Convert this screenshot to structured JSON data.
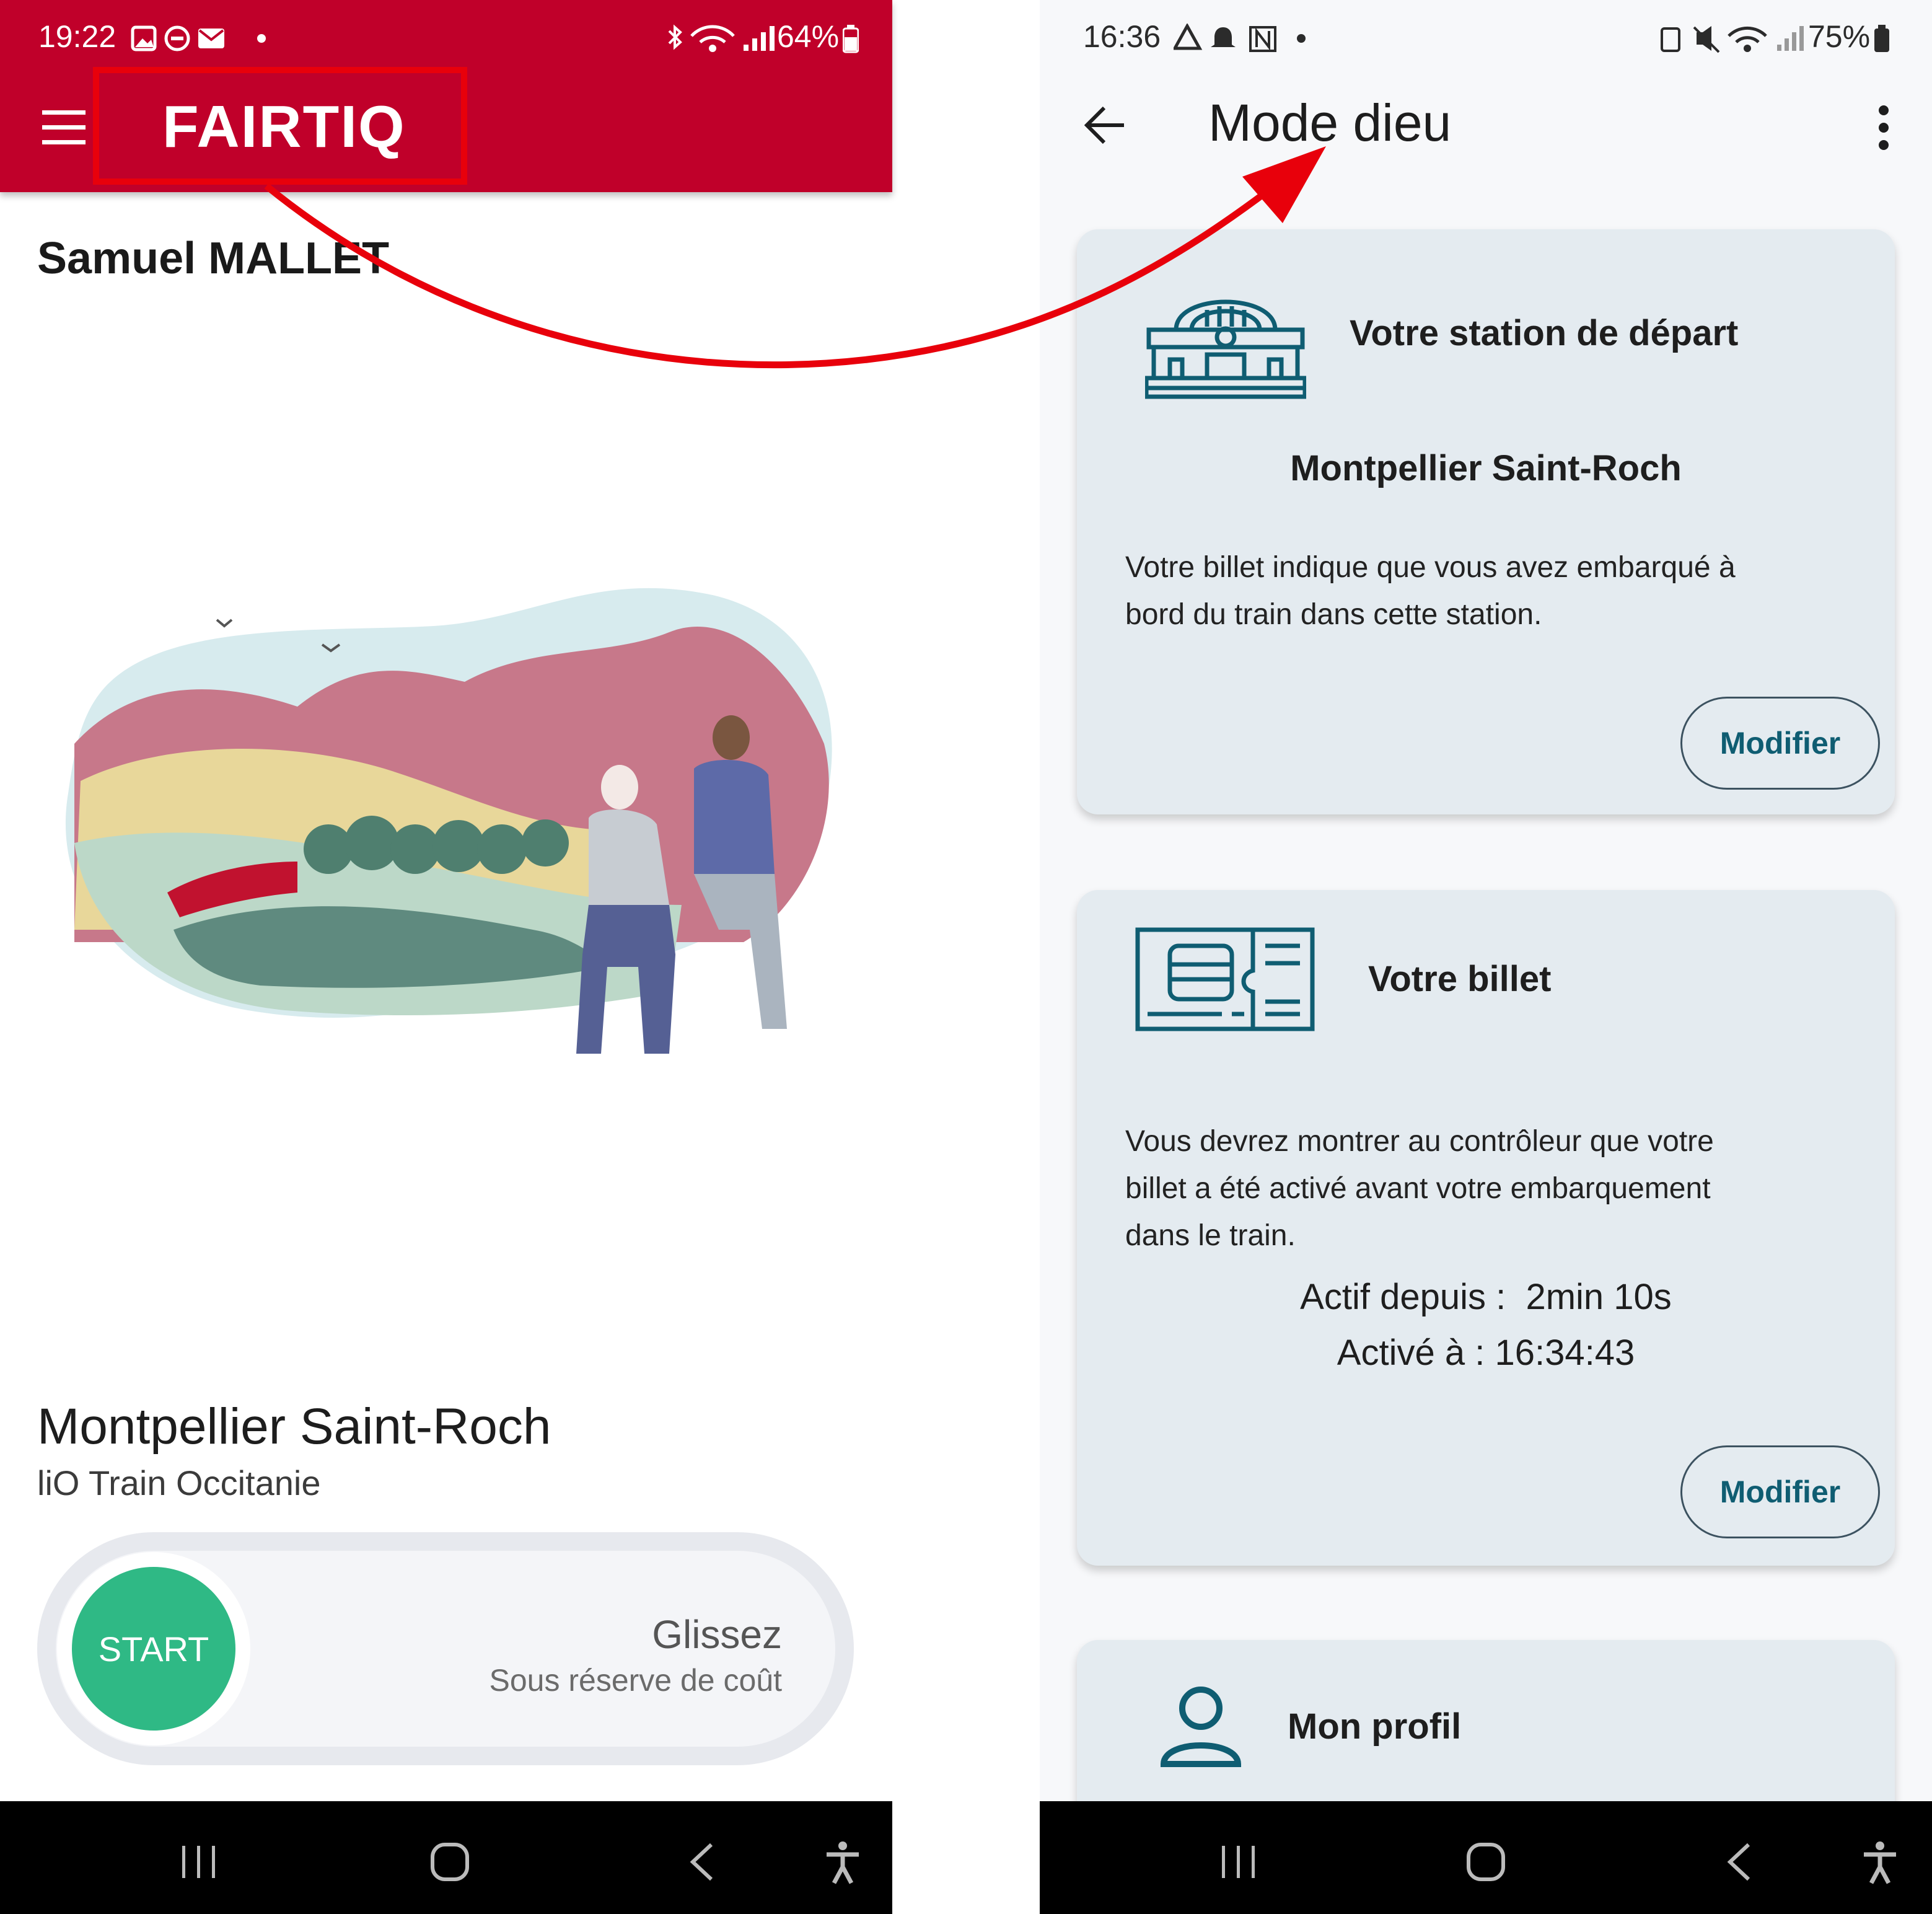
{
  "left": {
    "status": {
      "time": "19:22",
      "battery": "64%"
    },
    "header": {
      "logo": "FAIRTIQ"
    },
    "user_name": "Samuel MALLET",
    "station": "Montpellier Saint-Roch",
    "operator": "liO Train Occitanie",
    "start_label": "START",
    "slide_title": "Glissez",
    "slide_sub": "Sous réserve de coût"
  },
  "right": {
    "status": {
      "time": "16:36",
      "battery": "75%"
    },
    "title": "Mode dieu",
    "card1": {
      "title": "Votre station de départ",
      "station": "Montpellier Saint-Roch",
      "desc_line1": "Votre billet indique que vous avez embarqué à",
      "desc_line2": "bord du train dans cette station.",
      "button": "Modifier"
    },
    "card2": {
      "title": "Votre billet",
      "desc_line1": "Vous devrez montrer au contrôleur que votre",
      "desc_line2": "billet a été activé avant votre embarquement",
      "desc_line3": "dans le train.",
      "active_since": "Actif depuis :  2min 10s",
      "activated_at": "Activé à : 16:34:43",
      "button": "Modifier"
    },
    "card3": {
      "title": "Mon profil"
    }
  },
  "colors": {
    "brand": "#c0002a",
    "start": "#2fb985",
    "teal": "#0f5d72",
    "annotation": "#e8000b"
  }
}
